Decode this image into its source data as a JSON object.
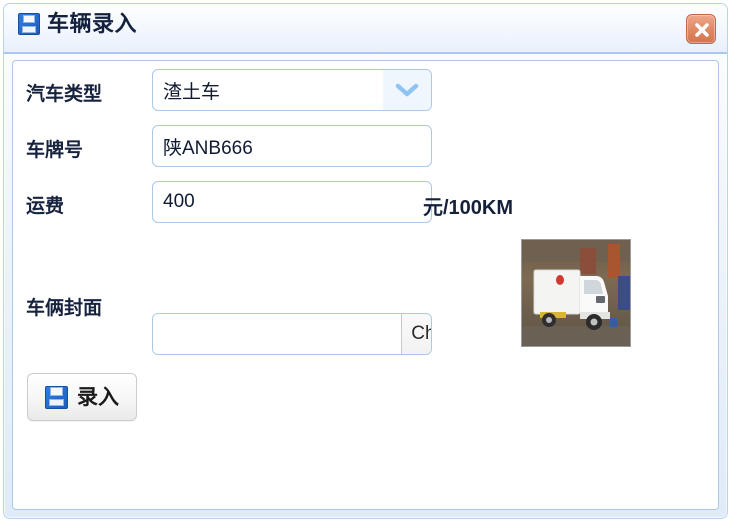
{
  "window": {
    "title": "车辆录入",
    "title_icon": "save-floppy-icon",
    "close_icon": "close-x-icon",
    "frame_color": "#b9d2ef",
    "title_border_color": "#a9c8ec",
    "close_button_color": "#dd8a62"
  },
  "form": {
    "fields": [
      {
        "label": "汽车类型",
        "type": "select",
        "value": "渣土车",
        "options": [
          "渣土车"
        ],
        "arrow_icon": "chevron-down-icon"
      },
      {
        "label": "车牌号",
        "type": "text",
        "value": "陕ANB666",
        "placeholder": ""
      },
      {
        "label": "运费",
        "type": "text",
        "value": "400",
        "placeholder": "",
        "suffix": "元/100KM"
      },
      {
        "label": "车俩封面",
        "type": "file",
        "value": "",
        "placeholder": "",
        "button_label": "Choose File"
      }
    ],
    "preview": {
      "alt": "truck-cover-photo",
      "icon": "white-box-truck-photo"
    },
    "submit": {
      "label": "录入",
      "icon": "save-floppy-icon"
    }
  }
}
